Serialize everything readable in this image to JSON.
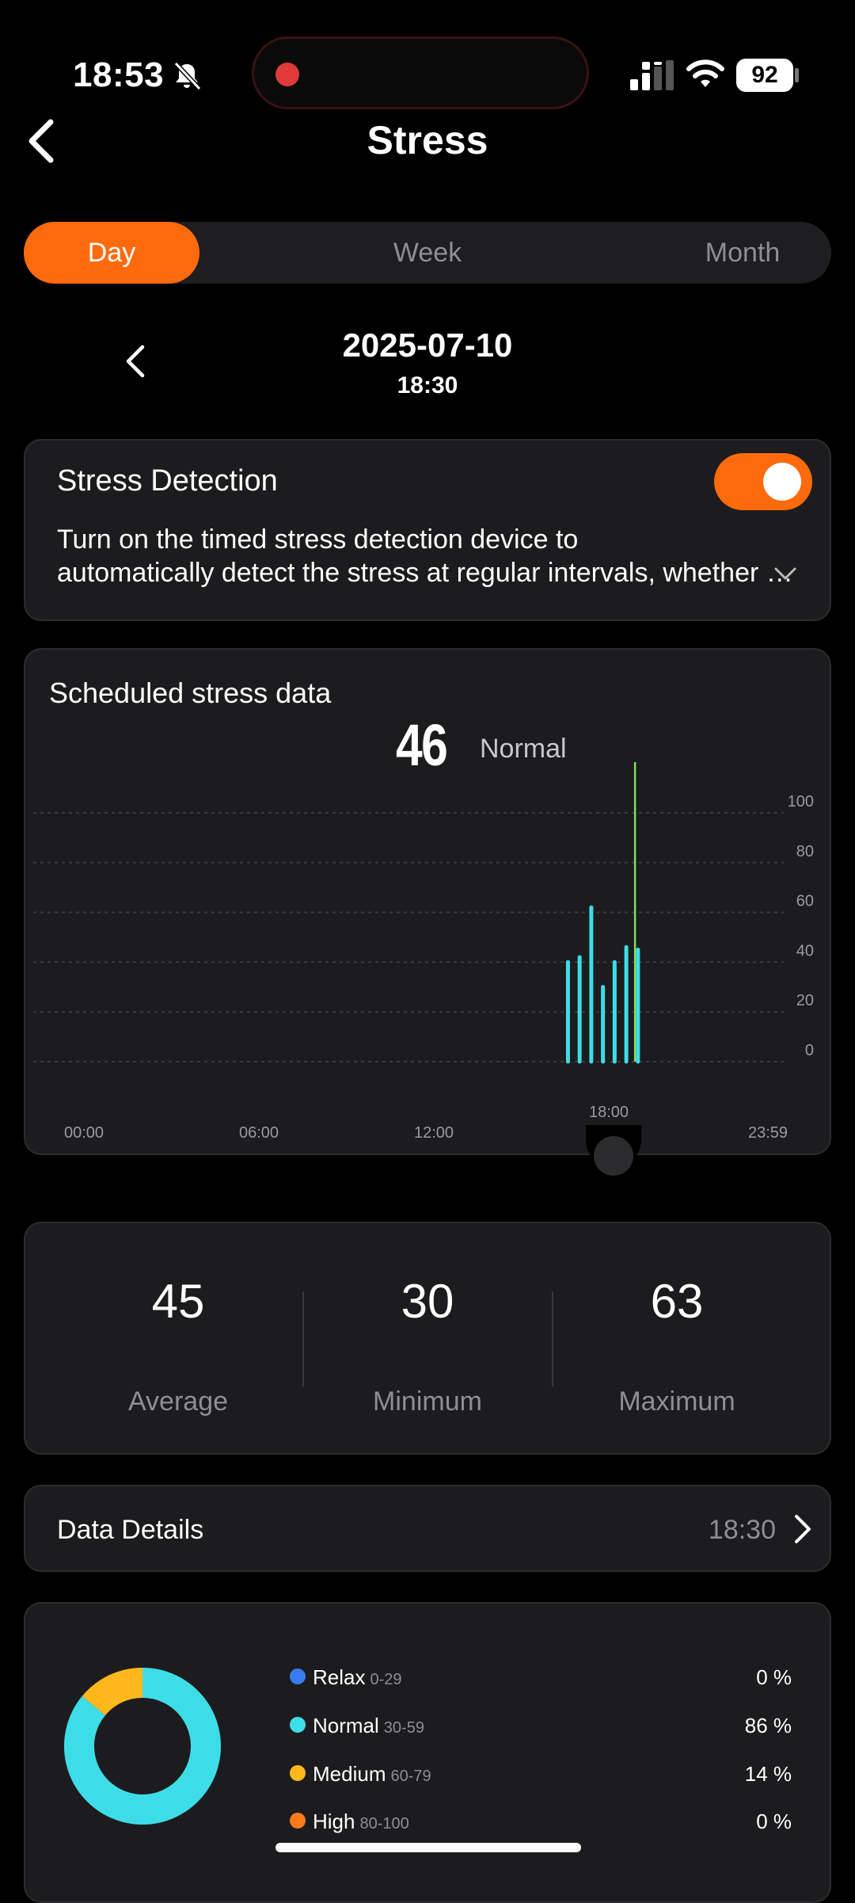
{
  "status_bar": {
    "time": "18:53",
    "battery": "92"
  },
  "nav": {
    "title": "Stress"
  },
  "tabs": [
    {
      "label": "Day",
      "active": true
    },
    {
      "label": "Week",
      "active": false
    },
    {
      "label": "Month",
      "active": false
    }
  ],
  "date": {
    "day": "2025-07-10",
    "time": "18:30"
  },
  "stress_detection": {
    "title": "Stress Detection",
    "enabled": true,
    "description_line1": "Turn on the timed stress detection device to",
    "description_line2": "automatically detect the stress at regular intervals, whether you are exercising or not"
  },
  "chart_card": {
    "title": "Scheduled stress data",
    "current_value": "46",
    "current_level": "Normal"
  },
  "chart_data": {
    "type": "bar",
    "x_range": [
      "00:00",
      "23:59"
    ],
    "x_ticks": [
      "00:00",
      "06:00",
      "12:00",
      "18:00",
      "23:59"
    ],
    "y_ticks": [
      "100",
      "80",
      "60",
      "40",
      "20",
      "0"
    ],
    "ylim": [
      0,
      100
    ],
    "selected_time": "18:30",
    "bars": [
      {
        "time_hours": 16.6,
        "value": 40
      },
      {
        "time_hours": 17.0,
        "value": 42
      },
      {
        "time_hours": 17.4,
        "value": 62
      },
      {
        "time_hours": 17.8,
        "value": 30
      },
      {
        "time_hours": 18.2,
        "value": 40
      },
      {
        "time_hours": 18.6,
        "value": 46
      },
      {
        "time_hours": 19.0,
        "value": 45
      }
    ],
    "bar_color": "#3ddde8",
    "cursor_color": "#7be05a"
  },
  "summary": {
    "average": {
      "value": "45",
      "label": "Average"
    },
    "minimum": {
      "value": "30",
      "label": "Minimum"
    },
    "maximum": {
      "value": "63",
      "label": "Maximum"
    }
  },
  "data_details": {
    "label": "Data Details",
    "value": "18:30"
  },
  "distribution": [
    {
      "name": "Relax",
      "range": "0-29",
      "percent": "0 %",
      "fraction": 0,
      "color": "#3a7bf0"
    },
    {
      "name": "Normal",
      "range": "30-59",
      "percent": "86 %",
      "fraction": 0.86,
      "color": "#3ddde8"
    },
    {
      "name": "Medium",
      "range": "60-79",
      "percent": "14 %",
      "fraction": 0.14,
      "color": "#ffb81c"
    },
    {
      "name": "High",
      "range": "80-100",
      "percent": "0 %",
      "fraction": 0,
      "color": "#ff7a1a"
    }
  ],
  "colors": {
    "accent": "#ff6a0c",
    "card": "#1c1c1e",
    "background": "#000000"
  }
}
